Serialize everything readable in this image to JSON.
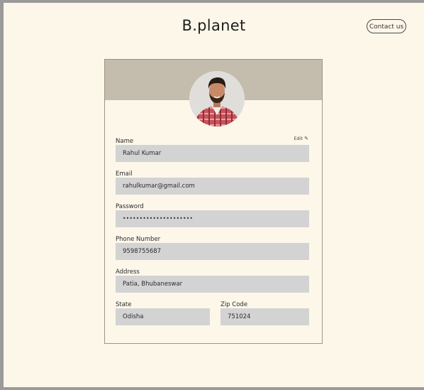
{
  "header": {
    "brand": "B.planet",
    "contact_label": "Contact us"
  },
  "profile": {
    "edit_label": "Edit",
    "fields": {
      "name": {
        "label": "Name",
        "value": "Rahul Kumar"
      },
      "email": {
        "label": "Email",
        "value": "rahulkumar@gmail.com"
      },
      "password": {
        "label": "Password",
        "value": "•••••••••••••••••••••"
      },
      "phone": {
        "label": "Phone Number",
        "value": "9598755687"
      },
      "address": {
        "label": "Address",
        "value": "Patia, Bhubaneswar"
      },
      "state": {
        "label": "State",
        "value": "Odisha"
      },
      "zip": {
        "label": "Zip Code",
        "value": "751024"
      }
    }
  },
  "colors": {
    "page_bg": "#fdf7ea",
    "banner": "#c4bcad",
    "field_bg": "#d3d3d3",
    "card_border": "#a09484"
  },
  "icons": [
    "pencil-icon",
    "profile-avatar"
  ]
}
